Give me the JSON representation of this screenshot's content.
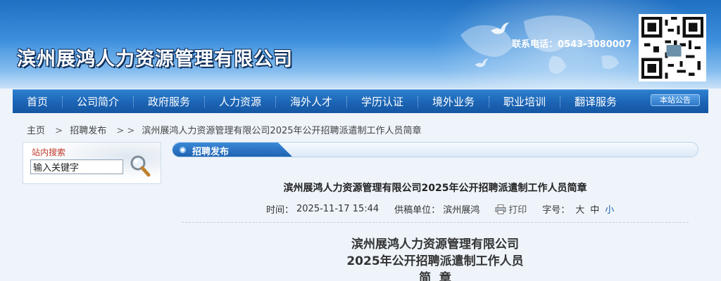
{
  "header": {
    "company_name": "滨州展鸿人力资源管理有限公司",
    "contact": "联系电话：0543-3080007"
  },
  "nav": {
    "items": [
      {
        "label": "首页"
      },
      {
        "label": "公司简介"
      },
      {
        "label": "政府服务"
      },
      {
        "label": "人力资源"
      },
      {
        "label": "海外人才"
      },
      {
        "label": "学历认证"
      },
      {
        "label": "境外业务"
      },
      {
        "label": "职业培训"
      },
      {
        "label": "翻译服务"
      }
    ],
    "notice_button": "本站公告"
  },
  "breadcrumb": {
    "home": "主页",
    "sep1": ">",
    "category": "招聘发布",
    "sep2": "> >",
    "current": "滨州展鸿人力资源管理有限公司2025年公开招聘派遣制工作人员简章"
  },
  "search": {
    "title": "站内搜索",
    "value": "输入关键字"
  },
  "section": {
    "title": "招聘发布"
  },
  "article": {
    "title": "滨州展鸿人力资源管理有限公司2025年公开招聘派遣制工作人员简章",
    "time_label": "时间：",
    "time_value": "2025-11-17 15:44",
    "source_label": "供稿单位：",
    "source_value": "滨州展鸿",
    "print_label": "打印",
    "font_label": "字号：",
    "font_large": "大",
    "font_medium": "中",
    "font_small": "小",
    "heading_line1": "滨州展鸿人力资源管理有限公司",
    "heading_line2": "2025年公开招聘派遣制工作人员",
    "heading_line3": "简  章"
  },
  "colors": {
    "nav_bg": "#1c64b4",
    "accent_red": "#c0392b",
    "link_blue": "#1a5fb0"
  }
}
